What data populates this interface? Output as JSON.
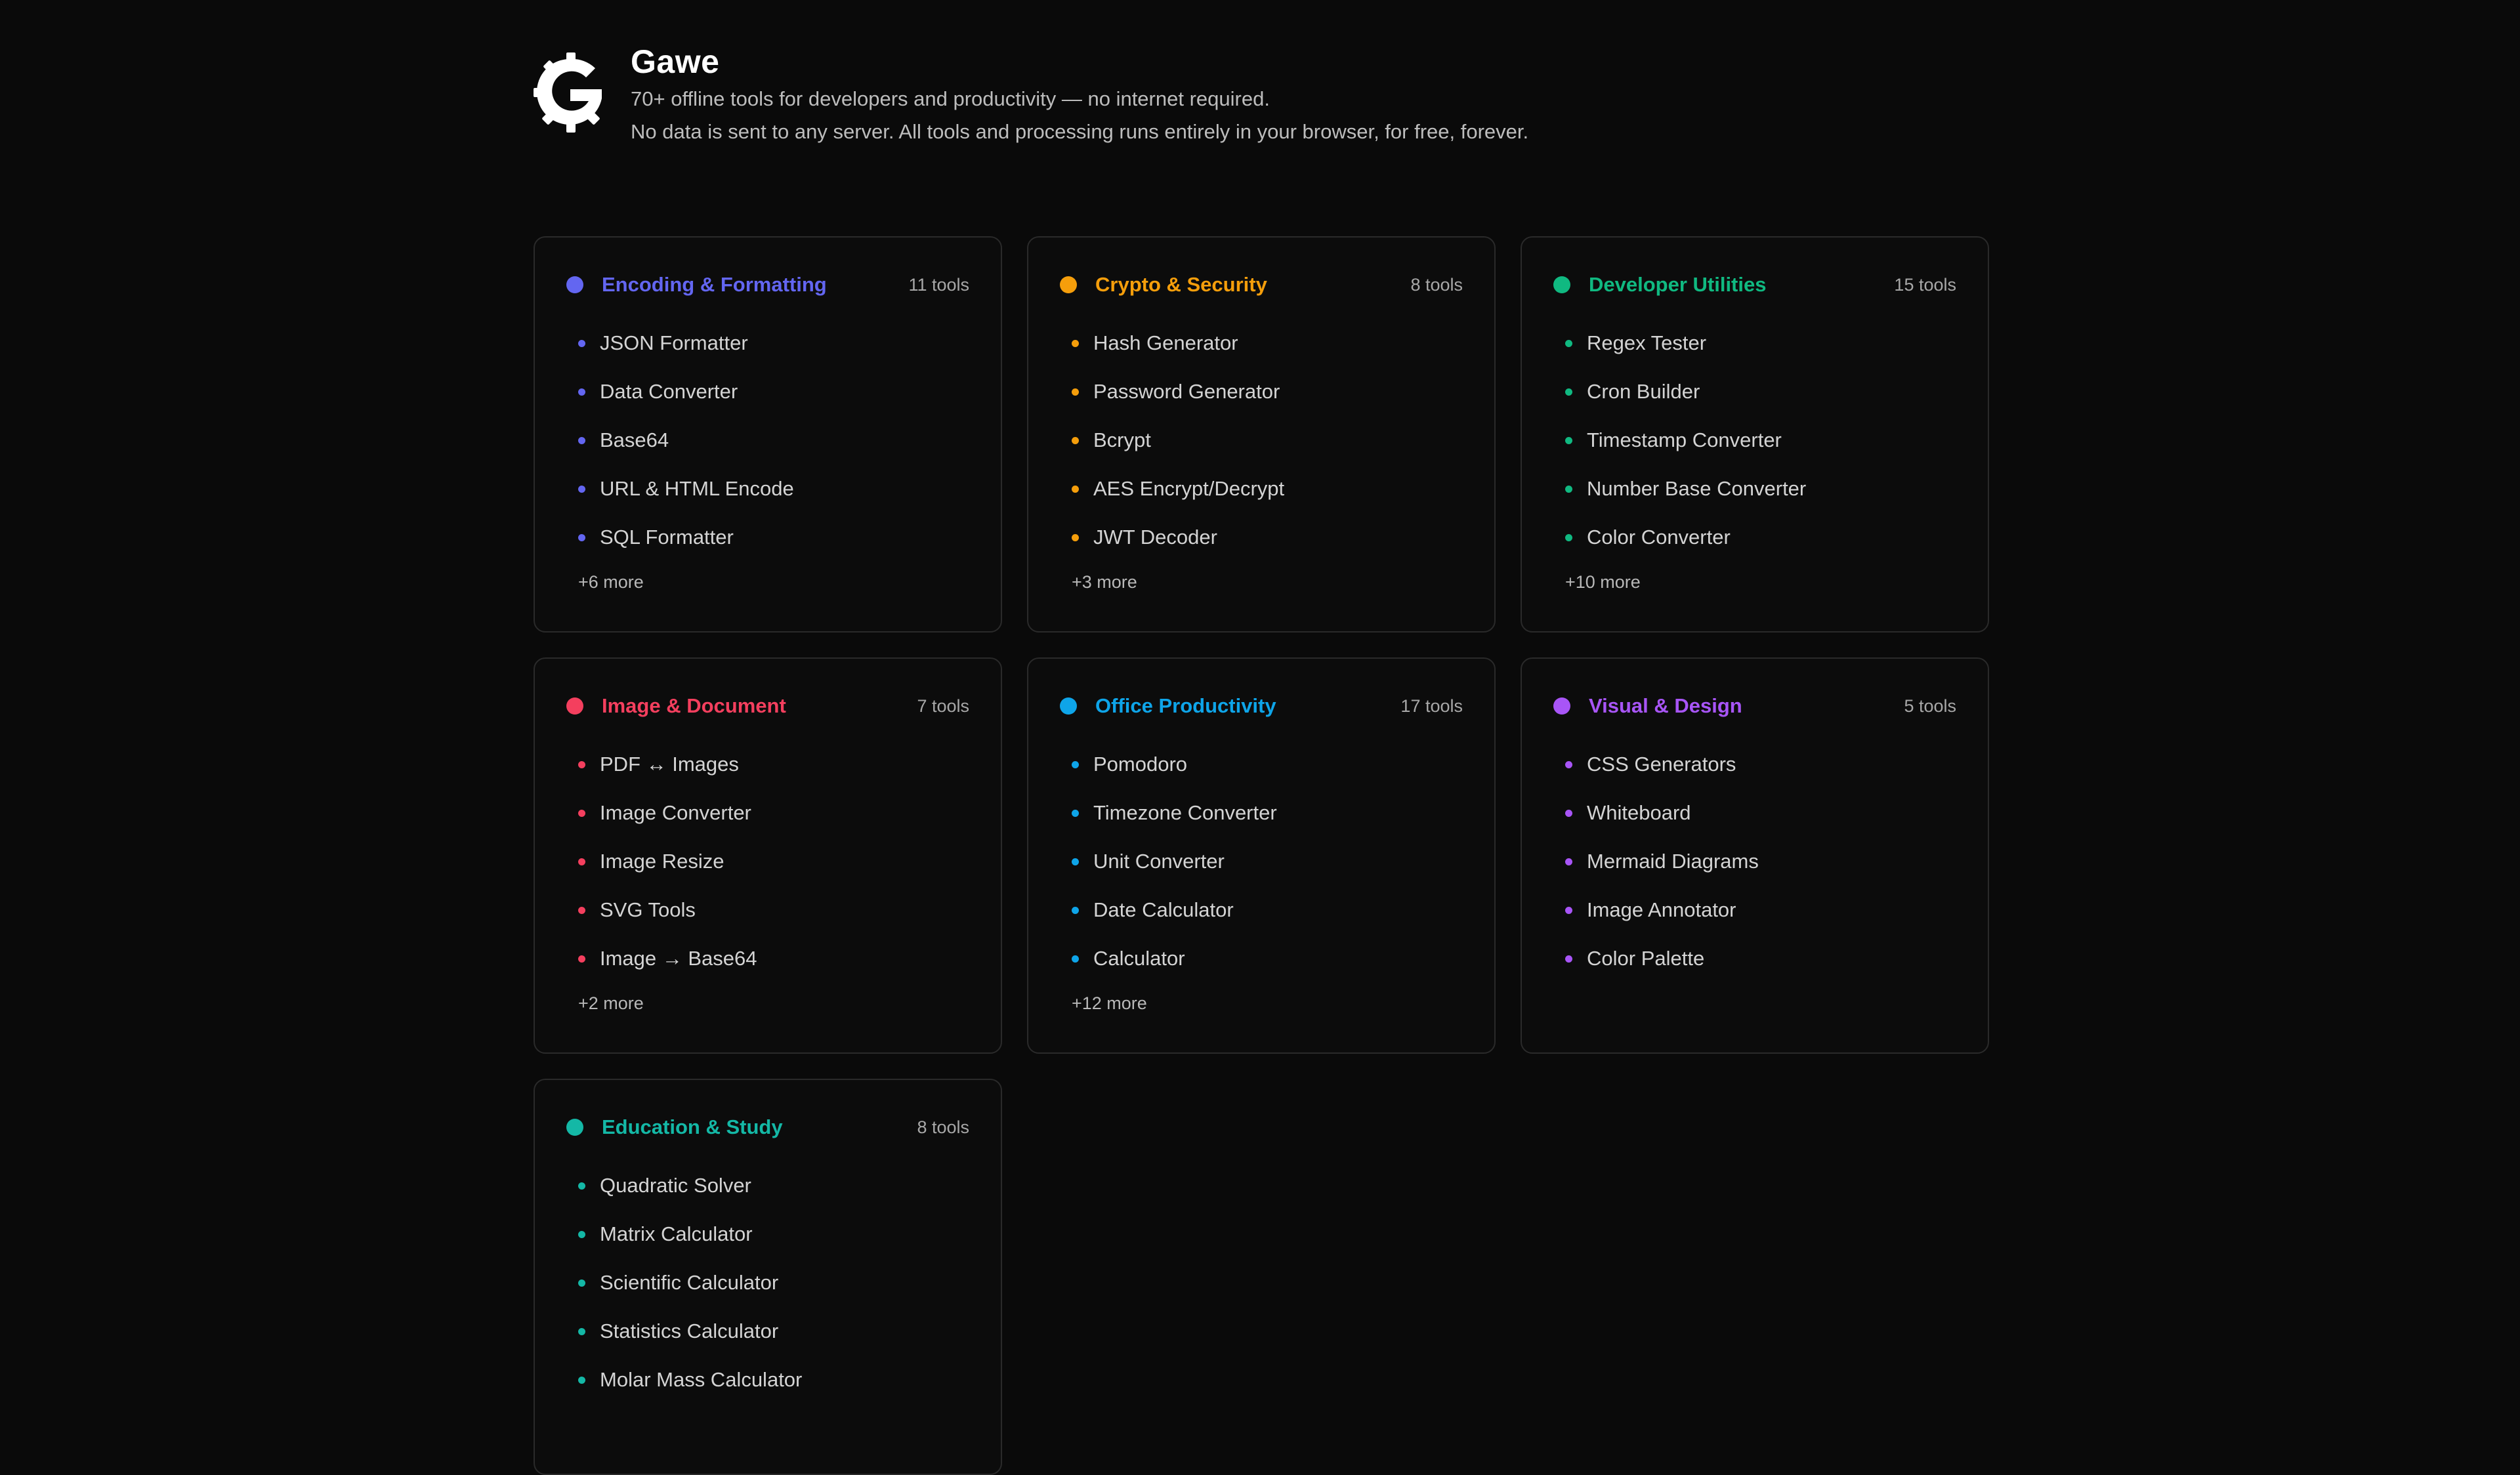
{
  "header": {
    "title": "Gawe",
    "subtitle_line1": "70+ offline tools for developers and productivity — no internet required.",
    "subtitle_line2": "No data is sent to any server. All tools and processing runs entirely in your browser, for free, forever."
  },
  "categories": [
    {
      "title": "Encoding & Formatting",
      "count": "11 tools",
      "color": "#6366f1",
      "tools": [
        "JSON Formatter",
        "Data Converter",
        "Base64",
        "URL & HTML Encode",
        "SQL Formatter"
      ],
      "more": "+6 more"
    },
    {
      "title": "Crypto & Security",
      "count": "8 tools",
      "color": "#f59e0b",
      "tools": [
        "Hash Generator",
        "Password Generator",
        "Bcrypt",
        "AES Encrypt/Decrypt",
        "JWT Decoder"
      ],
      "more": "+3 more"
    },
    {
      "title": "Developer Utilities",
      "count": "15 tools",
      "color": "#10b981",
      "tools": [
        "Regex Tester",
        "Cron Builder",
        "Timestamp Converter",
        "Number Base Converter",
        "Color Converter"
      ],
      "more": "+10 more"
    },
    {
      "title": "Image & Document",
      "count": "7 tools",
      "color": "#f43f5e",
      "tools": [
        "PDF ↔ Images",
        "Image Converter",
        "Image Resize",
        "SVG Tools",
        "Image → Base64"
      ],
      "more": "+2 more"
    },
    {
      "title": "Office Productivity",
      "count": "17 tools",
      "color": "#0ea5e9",
      "tools": [
        "Pomodoro",
        "Timezone Converter",
        "Unit Converter",
        "Date Calculator",
        "Calculator"
      ],
      "more": "+12 more"
    },
    {
      "title": "Visual & Design",
      "count": "5 tools",
      "color": "#a855f7",
      "tools": [
        "CSS Generators",
        "Whiteboard",
        "Mermaid Diagrams",
        "Image Annotator",
        "Color Palette"
      ],
      "more": ""
    },
    {
      "title": "Education & Study",
      "count": "8 tools",
      "color": "#14b8a6",
      "tools": [
        "Quadratic Solver",
        "Matrix Calculator",
        "Scientific Calculator",
        "Statistics Calculator",
        "Molar Mass Calculator"
      ],
      "more": ""
    }
  ]
}
